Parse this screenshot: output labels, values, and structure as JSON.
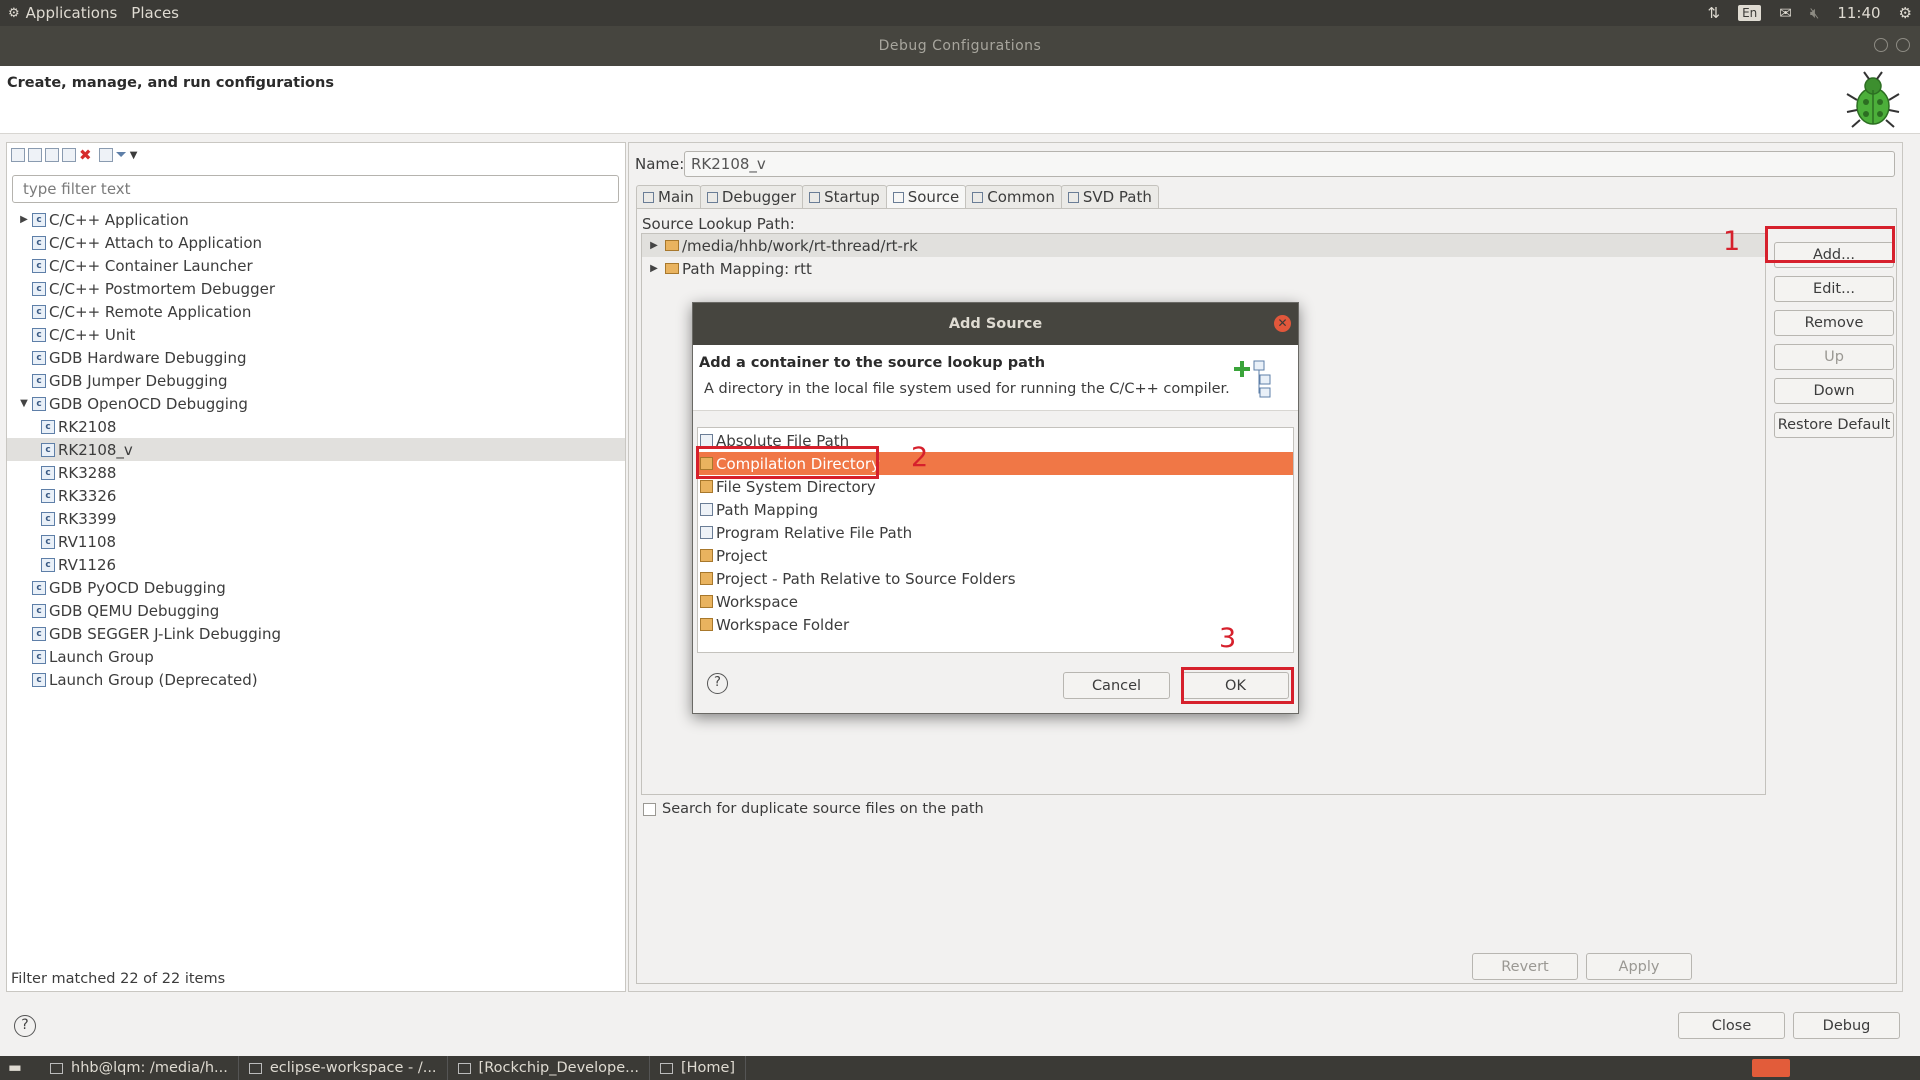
{
  "top_panel": {
    "applications": "Applications",
    "places": "Places",
    "lang": "En",
    "clock": "11:40"
  },
  "window": {
    "title": "Debug Configurations"
  },
  "banner": {
    "heading": "Create, manage, and run configurations"
  },
  "left": {
    "filter_placeholder": "type filter text",
    "tree": [
      {
        "label": "C/C++ Application",
        "level": 0,
        "expander": "collapsed"
      },
      {
        "label": "C/C++ Attach to Application",
        "level": 0
      },
      {
        "label": "C/C++ Container Launcher",
        "level": 0
      },
      {
        "label": "C/C++ Postmortem Debugger",
        "level": 0
      },
      {
        "label": "C/C++ Remote Application",
        "level": 0
      },
      {
        "label": "C/C++ Unit",
        "level": 0
      },
      {
        "label": "GDB Hardware Debugging",
        "level": 0
      },
      {
        "label": "GDB Jumper Debugging",
        "level": 0
      },
      {
        "label": "GDB OpenOCD Debugging",
        "level": 0,
        "expander": "expanded"
      },
      {
        "label": "RK2108",
        "level": 1
      },
      {
        "label": "RK2108_v",
        "level": 1,
        "selected": true
      },
      {
        "label": "RK3288",
        "level": 1
      },
      {
        "label": "RK3326",
        "level": 1
      },
      {
        "label": "RK3399",
        "level": 1
      },
      {
        "label": "RV1108",
        "level": 1
      },
      {
        "label": "RV1126",
        "level": 1
      },
      {
        "label": "GDB PyOCD Debugging",
        "level": 0
      },
      {
        "label": "GDB QEMU Debugging",
        "level": 0
      },
      {
        "label": "GDB SEGGER J-Link Debugging",
        "level": 0
      },
      {
        "label": "Launch Group",
        "level": 0
      },
      {
        "label": "Launch Group (Deprecated)",
        "level": 0
      }
    ],
    "status": "Filter matched 22 of 22 items"
  },
  "right": {
    "name_label": "Name:",
    "name_value": "RK2108_v",
    "tabs": [
      {
        "label": "Main"
      },
      {
        "label": "Debugger"
      },
      {
        "label": "Startup"
      },
      {
        "label": "Source",
        "active": true
      },
      {
        "label": "Common"
      },
      {
        "label": "SVD Path"
      }
    ],
    "source_label": "Source Lookup Path:",
    "source_entries": [
      {
        "label": "/media/hhb/work/rt-thread/rt-rk"
      },
      {
        "label": "Path Mapping: rtt"
      }
    ],
    "side_buttons": [
      {
        "label": "Add...",
        "disabled": false
      },
      {
        "label": "Edit...",
        "disabled": false
      },
      {
        "label": "Remove",
        "disabled": false
      },
      {
        "label": "Up",
        "disabled": true
      },
      {
        "label": "Down",
        "disabled": false
      },
      {
        "label": "Restore Default",
        "disabled": false
      }
    ],
    "dup_checkbox": "Search for duplicate source files on the path",
    "revert": "Revert",
    "apply": "Apply"
  },
  "footer": {
    "close": "Close",
    "debug": "Debug"
  },
  "dialog": {
    "title": "Add Source",
    "heading": "Add a container to the source lookup path",
    "description": "A directory in the local file system used for running the C/C++ compiler.",
    "items": [
      {
        "label": "Absolute File Path"
      },
      {
        "label": "Compilation Directory",
        "selected": true
      },
      {
        "label": "File System Directory"
      },
      {
        "label": "Path Mapping"
      },
      {
        "label": "Program Relative File Path"
      },
      {
        "label": "Project"
      },
      {
        "label": "Project - Path Relative to Source Folders"
      },
      {
        "label": "Workspace"
      },
      {
        "label": "Workspace Folder"
      }
    ],
    "cancel": "Cancel",
    "ok": "OK"
  },
  "annotations": {
    "step1": "1",
    "step2": "2",
    "step3": "3"
  },
  "taskbar": {
    "items": [
      {
        "label": "hhb@lqm: /media/h..."
      },
      {
        "label": "eclipse-workspace - /..."
      },
      {
        "label": "[Rockchip_Develope..."
      },
      {
        "label": "[Home]"
      }
    ]
  },
  "colors": {
    "selection": "#f07746",
    "annotation": "#d6202c",
    "panel": "#3b3a36"
  }
}
